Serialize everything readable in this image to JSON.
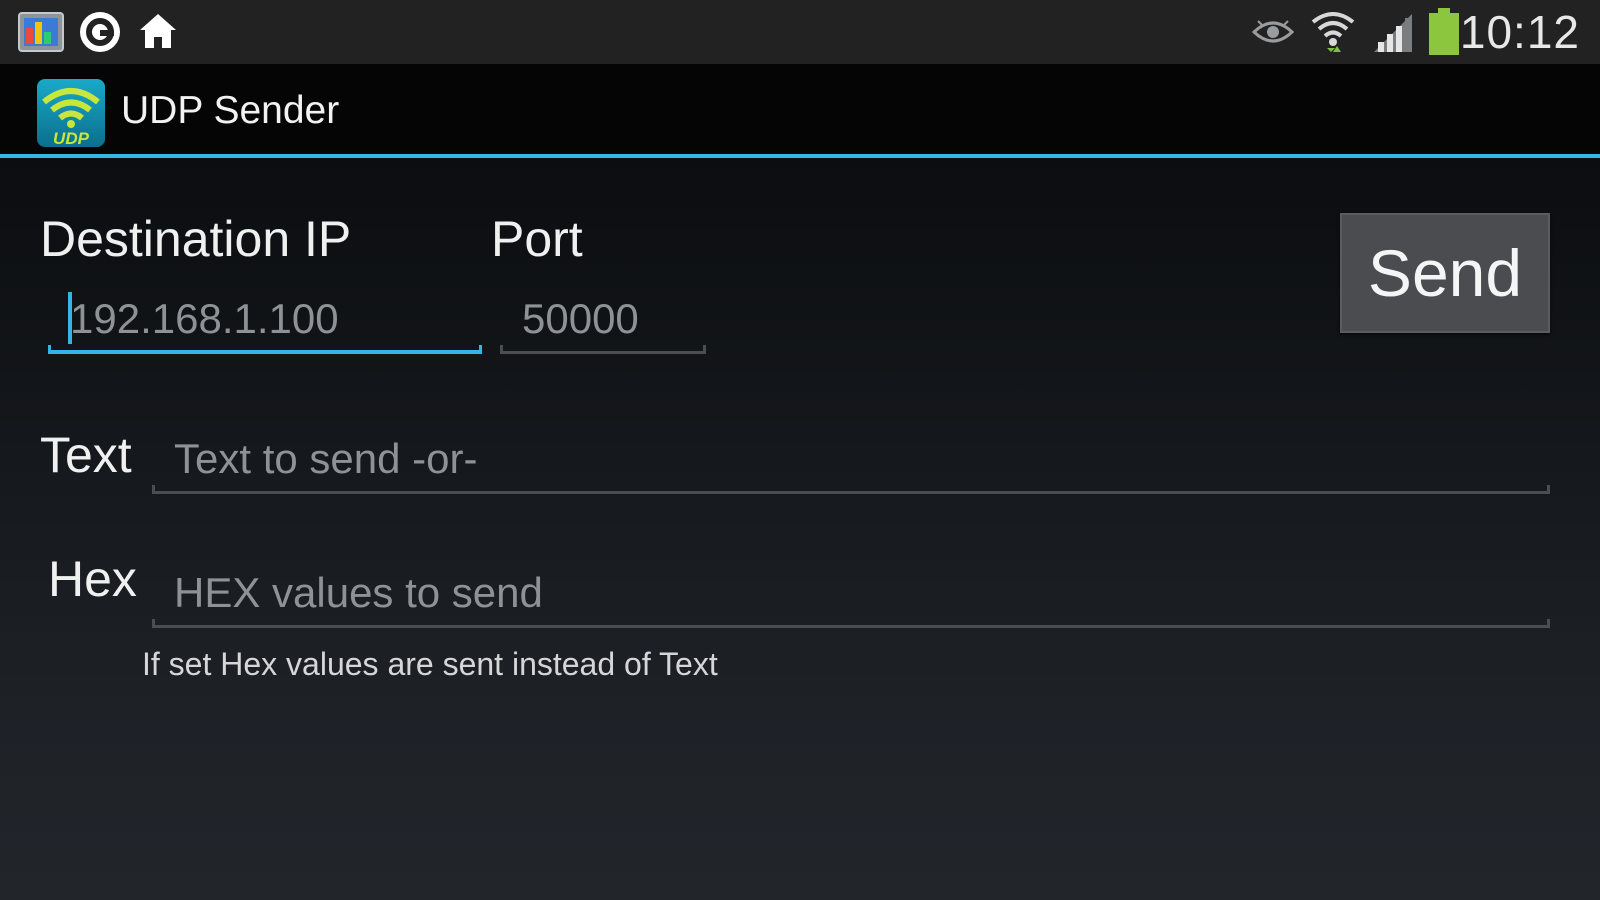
{
  "status_bar": {
    "left_icons": [
      "gallery-icon",
      "sync-circle-icon",
      "home-icon"
    ],
    "right_icons": [
      "eye-icon",
      "wifi-icon",
      "signal-icon",
      "battery-icon"
    ],
    "time": "10:12"
  },
  "action_bar": {
    "app_icon_text": "UDP",
    "title": "UDP Sender",
    "accent_color": "#33b5e5"
  },
  "form": {
    "destination_ip": {
      "label": "Destination IP",
      "placeholder": "192.168.1.100",
      "focused": true
    },
    "port": {
      "label": "Port",
      "placeholder": "50000"
    },
    "text": {
      "label": "Text",
      "placeholder": "Text to send -or-"
    },
    "hex": {
      "label": "Hex",
      "placeholder": "HEX values to send",
      "hint": "If set Hex values are sent instead of Text"
    },
    "send_label": "Send"
  }
}
